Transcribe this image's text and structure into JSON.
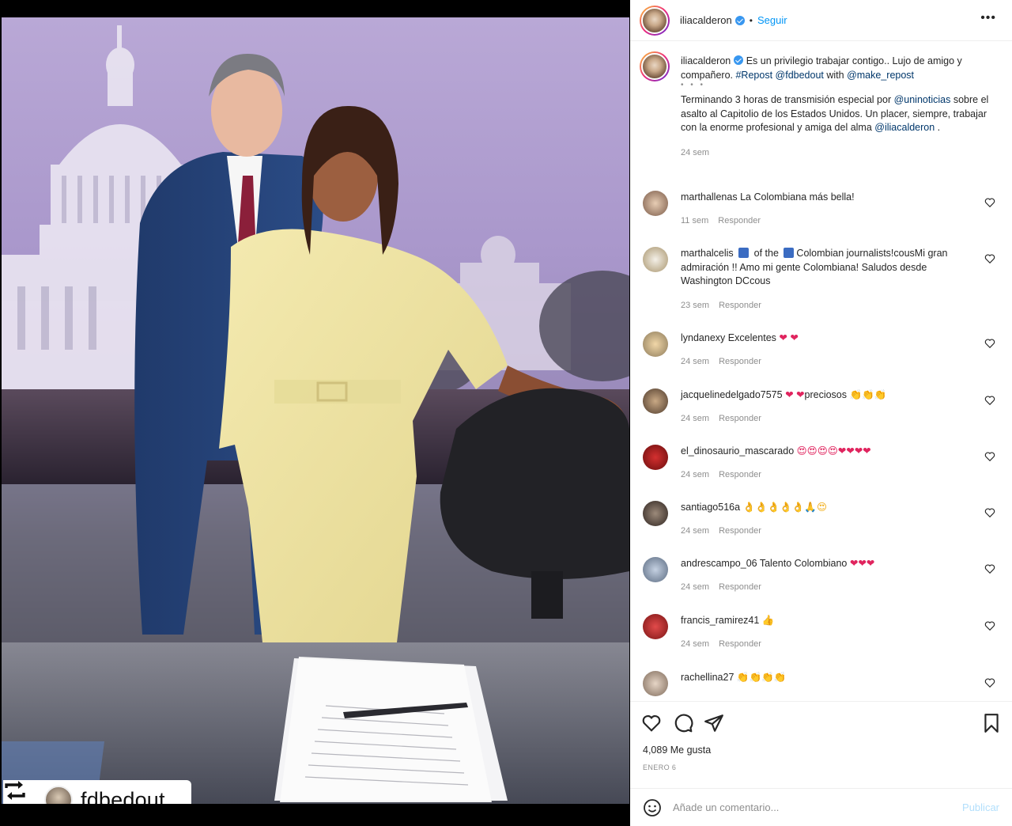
{
  "colors": {
    "accent": "#0095f6",
    "link": "#00376b",
    "heart": "#e0245e",
    "muted": "#8e8e8e"
  },
  "photo": {
    "repost_user": "fdbedout"
  },
  "header": {
    "username": "iliacalderon",
    "separator": "•",
    "follow_label": "Seguir",
    "more_icon": "more-horizontal-icon"
  },
  "caption": {
    "username": "iliacalderon",
    "line1": "Es un privilegio trabajar contigo.. Lujo de amigo y compañero. ",
    "hashtag": "#Repost",
    "mention1": "@fdbedout",
    "with_text": " with ",
    "mention2": "@make_repost",
    "dots": "• • •",
    "body1": "Terminando 3 horas de transmisión especial por ",
    "mention3": "@uninoticias",
    "body2": " sobre el asalto al Capitolio de los Estados Unidos. Un placer, siempre, trabajar con la enorme profesional y amiga del alma ",
    "mention4": "@iliacalderon",
    "body3": " .",
    "time": "24 sem"
  },
  "comments": [
    {
      "user": "marthallenas",
      "text": "La Colombiana más bella!",
      "time": "11 sem",
      "reply": "Responder"
    },
    {
      "user": "marthalcelis",
      "text_a": "of the",
      "text_b": "Colombian journalists!cousMi gran admiración !! Amo mi gente Colombiana! Saludos desde Washington DCcous",
      "time": "23 sem",
      "reply": "Responder"
    },
    {
      "user": "lyndanexy",
      "text": "Excelentes",
      "emoji": "❤ ❤",
      "time": "24 sem",
      "reply": "Responder"
    },
    {
      "user": "jacquelinedelgado7575",
      "emoji_a": "❤ ❤",
      "text": "preciosos",
      "emoji_b": "👏👏👏",
      "time": "24 sem",
      "reply": "Responder"
    },
    {
      "user": "el_dinosaurio_mascarado",
      "emoji": "😍😍😍😍❤❤❤❤",
      "time": "24 sem",
      "reply": "Responder"
    },
    {
      "user": "santiago516a",
      "emoji": "👌👌👌👌👌🙏😍",
      "time": "24 sem",
      "reply": "Responder"
    },
    {
      "user": "andrescampo_06",
      "text": "Talento Colombiano",
      "emoji": "❤❤❤",
      "time": "24 sem",
      "reply": "Responder"
    },
    {
      "user": "francis_ramirez41",
      "emoji": "👍",
      "time": "24 sem",
      "reply": "Responder"
    },
    {
      "user": "rachellina27",
      "emoji": "👏👏👏👏"
    }
  ],
  "actions": {
    "likes": "4,089 Me gusta",
    "date": "ENERO 6"
  },
  "add_comment": {
    "placeholder": "Añade un comentario...",
    "publish": "Publicar"
  }
}
